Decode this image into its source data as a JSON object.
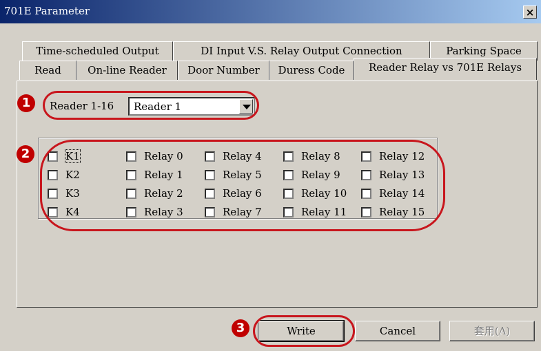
{
  "window": {
    "title": "701E Parameter",
    "close_symbol": "×"
  },
  "tabs_row1": [
    {
      "label": "Time-scheduled Output"
    },
    {
      "label": "DI Input  V.S. Relay Output Connection"
    },
    {
      "label": "Parking Space"
    }
  ],
  "tabs_row2": [
    {
      "label": "Read"
    },
    {
      "label": "On-line Reader"
    },
    {
      "label": "Door Number"
    },
    {
      "label": "Duress Code"
    },
    {
      "label": "Reader Relay vs 701E Relays",
      "active": true
    }
  ],
  "reader": {
    "label": "Reader 1-16",
    "selected": "Reader 1"
  },
  "checkboxes": {
    "k": [
      {
        "label": "K1",
        "checked": false
      },
      {
        "label": "K2",
        "checked": false
      },
      {
        "label": "K3",
        "checked": false
      },
      {
        "label": "K4",
        "checked": false
      }
    ],
    "relays": [
      {
        "label": "Relay 0",
        "checked": false
      },
      {
        "label": "Relay 1",
        "checked": false
      },
      {
        "label": "Relay 2",
        "checked": false
      },
      {
        "label": "Relay 3",
        "checked": false
      },
      {
        "label": "Relay 4",
        "checked": false
      },
      {
        "label": "Relay 5",
        "checked": false
      },
      {
        "label": "Relay 6",
        "checked": false
      },
      {
        "label": "Relay 7",
        "checked": false
      },
      {
        "label": "Relay 8",
        "checked": false
      },
      {
        "label": "Relay 9",
        "checked": false
      },
      {
        "label": "Relay 10",
        "checked": false
      },
      {
        "label": "Relay 11",
        "checked": false
      },
      {
        "label": "Relay 12",
        "checked": false
      },
      {
        "label": "Relay 13",
        "checked": false
      },
      {
        "label": "Relay 14",
        "checked": false
      },
      {
        "label": "Relay 15",
        "checked": false
      }
    ]
  },
  "buttons": {
    "write": "Write",
    "cancel": "Cancel",
    "apply": "套用(A)"
  },
  "markers": [
    "1",
    "2",
    "3"
  ],
  "colors": {
    "title_bar_start": "#0a246a",
    "title_bar_end": "#a6caf0",
    "highlight": "#c8161d",
    "marker": "#c00000",
    "face": "#d4d0c8"
  }
}
